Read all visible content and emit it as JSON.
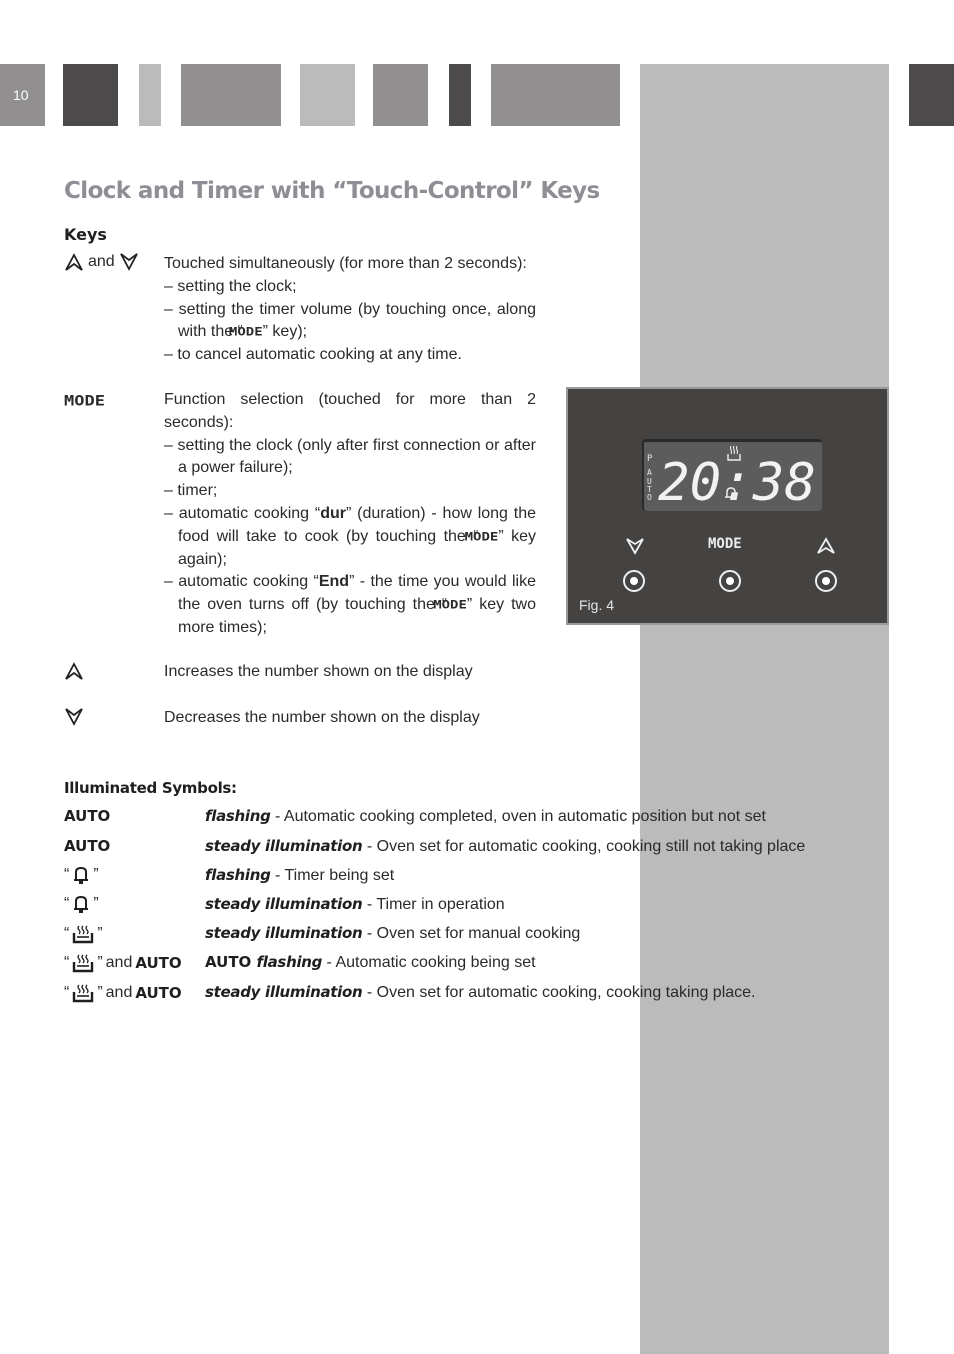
{
  "header": {
    "page_number": "10",
    "title": "Clock and Timer with “Touch-Control” Keys"
  },
  "keys": {
    "heading": "Keys",
    "and_word": "and",
    "mode_glyph": "MODE",
    "items": [
      {
        "key": "up-and-down",
        "intro": "Touched simultaneously (for more than 2 seconds):",
        "bullets": [
          "– setting the clock;",
          "– setting the timer volume (by touching once, along with the “MODE” key);",
          "– to cancel automatic cooking at any time."
        ]
      },
      {
        "key": "mode",
        "intro": "Function selection (touched for more than 2 seconds):",
        "bullets": [
          "– setting the clock (only after first connection or after a power failure);",
          "– timer;"
        ],
        "dur_prefix": "– automatic cooking “",
        "dur_word": "dur",
        "dur_suffix": "” (duration) - how long the food will take to cook (by touching the “",
        "dur_tail": "” key again);",
        "end_prefix": "– automatic cooking “",
        "end_word": "End",
        "end_suffix": "” - the time you would like the oven turns off (by touching the “",
        "end_tail": "” key two more times);"
      },
      {
        "key": "up",
        "desc": "Increases the number shown on the display"
      },
      {
        "key": "down",
        "desc": "Decreases the number shown on the display"
      }
    ]
  },
  "illuminated": {
    "heading": "Illuminated Symbols:",
    "quote_open": "“",
    "quote_close": "”",
    "and_word": "and",
    "auto": "AUTO",
    "rows": [
      {
        "symbol": "AUTO",
        "state": "flashing",
        "desc": " - Automatic cooking completed, oven in automatic position but not set"
      },
      {
        "symbol": "AUTO",
        "state": "steady illumination",
        "desc": " - Oven set for automatic cooking, cooking still not taking place"
      },
      {
        "symbol": "bell",
        "state": "flashing",
        "desc": " - Timer being set"
      },
      {
        "symbol": "bell",
        "state": "steady illumination",
        "desc": " - Timer in operation"
      },
      {
        "symbol": "heat",
        "state": "steady illumination",
        "desc": " - Oven set for manual cooking"
      },
      {
        "symbol": "heat+AUTO",
        "prefix": "AUTO ",
        "state": "flashing",
        "desc": " - Automatic cooking being set"
      },
      {
        "symbol": "heat+AUTO",
        "state": "steady illumination",
        "desc": " - Oven set for automatic cooking, cooking taking place."
      }
    ]
  },
  "figure": {
    "label": "Fig. 4",
    "display_time": "20:38",
    "indicator_p": "P",
    "indicator_auto": "AUTO",
    "mode_label": "MODE",
    "buttons": [
      "down",
      "mode",
      "up"
    ]
  },
  "colors": {
    "title": "#8d8f94",
    "dark_block": "#4c4a4b",
    "mid_block": "#918f90",
    "light_block": "#bbbbbb",
    "panel": "#444342",
    "lcd": "#5d5c5c"
  }
}
